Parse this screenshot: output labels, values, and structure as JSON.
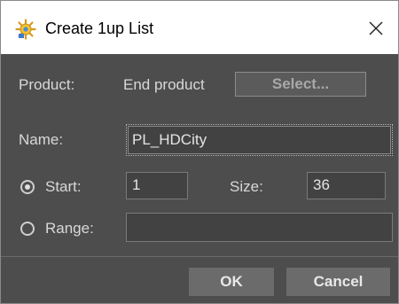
{
  "window": {
    "title": "Create 1up List",
    "icon": "cog-star-icon",
    "close_glyph": "✕"
  },
  "form": {
    "product_label": "Product:",
    "product_value": "End product",
    "select_button": "Select...",
    "name_label": "Name:",
    "name_value": "PL_HDCity",
    "start_label": "Start:",
    "start_value": "1",
    "start_selected": true,
    "size_label": "Size:",
    "size_value": "36",
    "range_label": "Range:",
    "range_value": "",
    "range_selected": false
  },
  "buttons": {
    "ok": "OK",
    "cancel": "Cancel"
  },
  "colors": {
    "background": "#4d4d4d",
    "titlebar": "#ffffff",
    "text": "#d8d8d8",
    "button": "#6b6b6b"
  }
}
